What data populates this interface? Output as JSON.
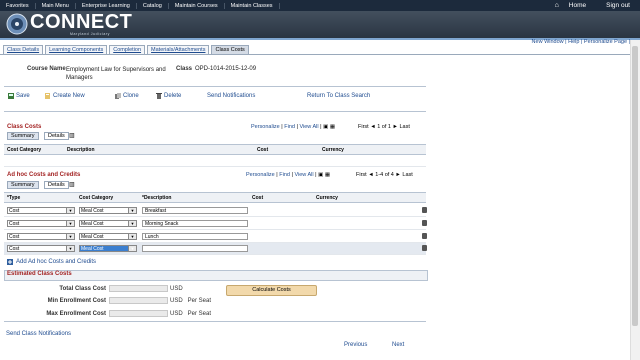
{
  "topnav": {
    "items": [
      "Favorites",
      "Main Menu",
      "Enterprise Learning",
      "Catalog",
      "Maintain Courses",
      "Maintain Classes"
    ],
    "home": "Home",
    "signout": "Sign out"
  },
  "brand": {
    "name": "CONNECT",
    "sub": "Maryland Judiciary"
  },
  "toplinks": "New Window | Help | Personalize Page |",
  "tabs": [
    "Class Details",
    "Learning Components",
    "Completion",
    "Materials/Attachments",
    "Class Costs"
  ],
  "header": {
    "course_label": "Course Name",
    "course_value": "Employment Law for Supervisors and Managers",
    "class_label": "Class",
    "class_value": "OPD-1014-2015-12-09"
  },
  "toolbar": {
    "save": "Save",
    "create": "Create New",
    "clone": "Clone",
    "delete": "Delete",
    "send": "Send Notifications",
    "return": "Return To Class Search"
  },
  "class_costs": {
    "title": "Class Costs",
    "nav": {
      "personalize": "Personalize",
      "find": "Find",
      "viewall": "View All",
      "first": "First",
      "count": "1 of 1",
      "last": "Last"
    },
    "tabs": [
      "Summary",
      "Details"
    ],
    "columns": [
      "Cost Category",
      "Description",
      "Cost",
      "Currency"
    ]
  },
  "adhoc": {
    "title": "Ad hoc Costs and Credits",
    "nav": {
      "personalize": "Personalize",
      "find": "Find",
      "viewall": "View All",
      "first": "First",
      "count": "1-4 of 4",
      "last": "Last"
    },
    "tabs": [
      "Summary",
      "Details"
    ],
    "columns": [
      "*Type",
      "Cost Category",
      "*Description",
      "Cost",
      "Currency"
    ],
    "rows": [
      {
        "type": "Cost",
        "category": "Meal Cost",
        "description": "Breakfast"
      },
      {
        "type": "Cost",
        "category": "Meal Cost",
        "description": "Morning Snack"
      },
      {
        "type": "Cost",
        "category": "Meal Cost",
        "description": "Lunch"
      },
      {
        "type": "Cost",
        "category": "Meal Cost",
        "description": ""
      }
    ],
    "add_link": "Add Ad hoc Costs and Credits"
  },
  "estimated": {
    "title": "Estimated Class Costs",
    "fields": [
      {
        "label": "Total Class Cost",
        "unit": "USD"
      },
      {
        "label": "Min Enrollment Cost",
        "unit": "USD   Per Seat"
      },
      {
        "label": "Max Enrollment Cost",
        "unit": "USD   Per Seat"
      }
    ],
    "calc_button": "Calculate Costs"
  },
  "send_link": "Send Class Notifications",
  "pager": {
    "previous": "Previous",
    "next": "Next"
  }
}
